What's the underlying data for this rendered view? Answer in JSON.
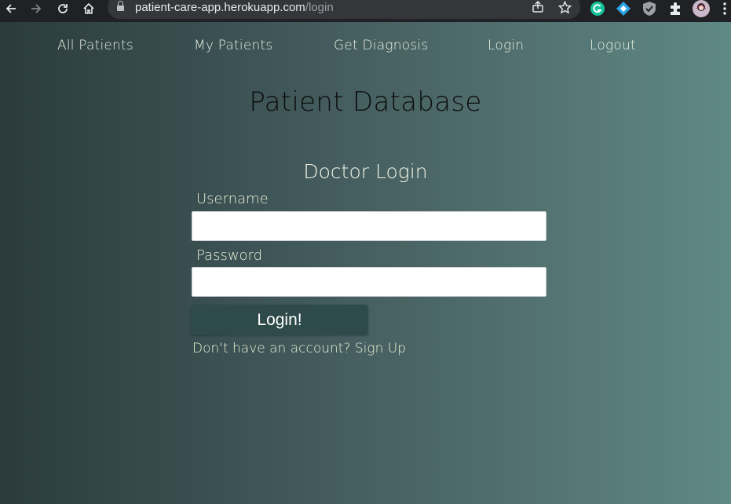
{
  "browser": {
    "url_host": "patient-care-app.herokuapp.com",
    "url_path": "/login",
    "icons": [
      "back-icon",
      "forward-icon",
      "reload-icon",
      "home-icon",
      "lock-icon",
      "share-icon",
      "star-icon",
      "grammarly-icon",
      "extension-diamond-icon",
      "shield-extension-icon",
      "puzzle-icon",
      "profile-avatar",
      "menu-icon"
    ]
  },
  "nav": {
    "items": [
      {
        "label": "All Patients"
      },
      {
        "label": "My Patients"
      },
      {
        "label": "Get Diagnosis"
      },
      {
        "label": "Login"
      },
      {
        "label": "Logout"
      }
    ]
  },
  "page": {
    "title": "Patient Database",
    "subtitle": "Doctor Login"
  },
  "form": {
    "username_label": "Username",
    "username_value": "",
    "password_label": "Password",
    "password_value": "",
    "submit_label": "Login!",
    "signup_prompt": "Don't have an account?",
    "signup_link": "Sign Up"
  },
  "colors": {
    "gradient_left": "#2b3b3d",
    "gradient_right": "#5f8985",
    "button_bg": "#2f4a4a",
    "text_light": "#e9f0d6",
    "title_dark": "#0c0c0c"
  }
}
